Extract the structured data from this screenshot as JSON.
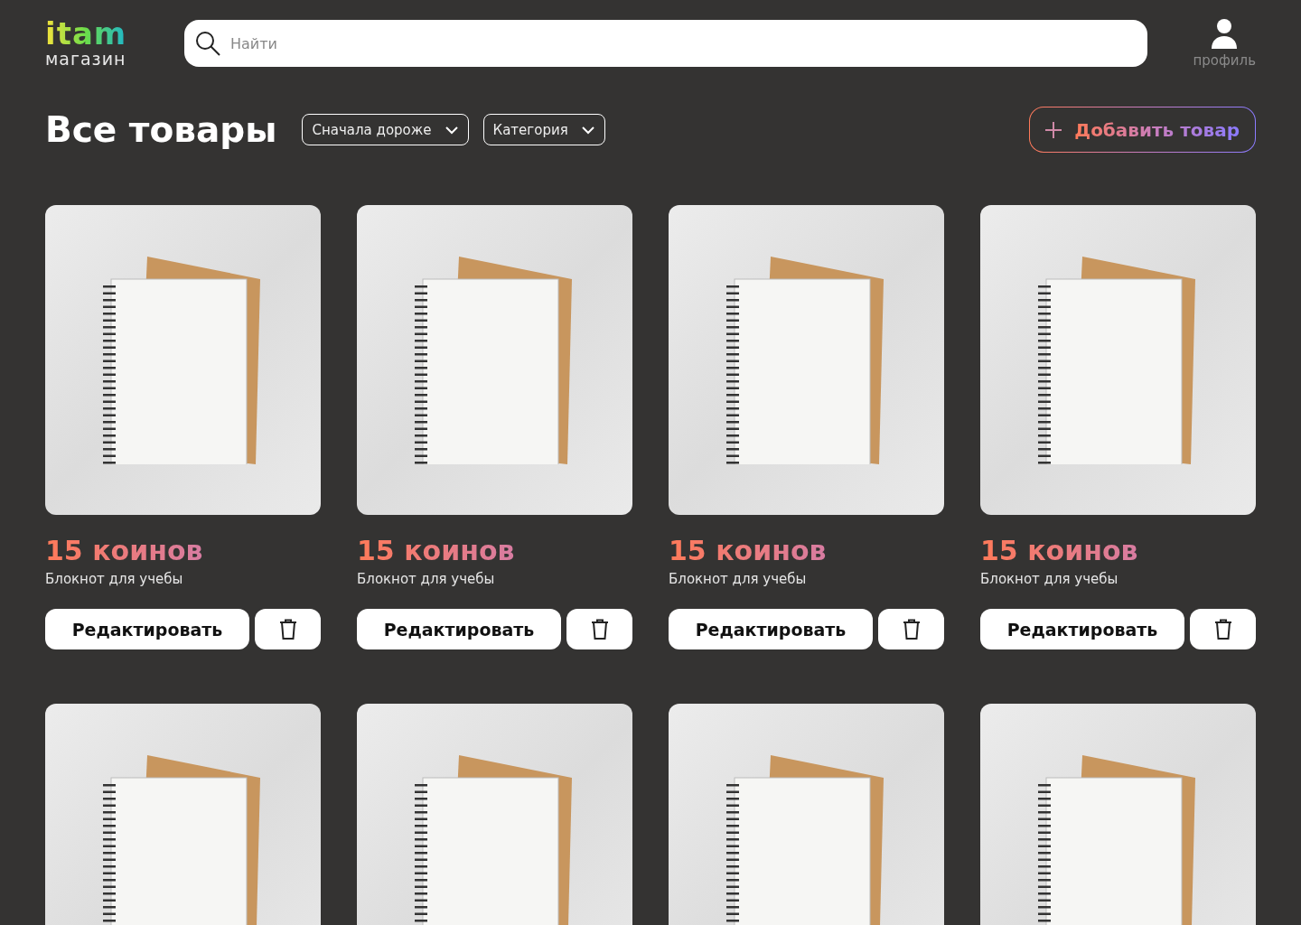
{
  "logo": {
    "brand": "itam",
    "subtitle": "магазин"
  },
  "search": {
    "placeholder": "Найти"
  },
  "profile": {
    "label": "профиль"
  },
  "title": "Все товары",
  "filters": [
    {
      "label": "Сначала дороже"
    },
    {
      "label": "Категория"
    }
  ],
  "add_button": "Добавить товар",
  "products": [
    {
      "kind": "card",
      "price": "15 коинов",
      "name": "Блокнот для учебы",
      "edit_label": "Редактировать"
    },
    {
      "kind": "card",
      "price": "15 коинов",
      "name": "Блокнот для учебы",
      "edit_label": "Редактировать"
    },
    {
      "kind": "card",
      "price": "15 коинов",
      "name": "Блокнот для учебы",
      "edit_label": "Редактировать"
    },
    {
      "kind": "card",
      "price": "15 коинов",
      "name": "Блокнот для учебы",
      "edit_label": "Редактировать"
    },
    {
      "kind": "photo_only"
    },
    {
      "kind": "photo_only"
    },
    {
      "kind": "photo_only"
    },
    {
      "kind": "photo_only"
    }
  ]
}
